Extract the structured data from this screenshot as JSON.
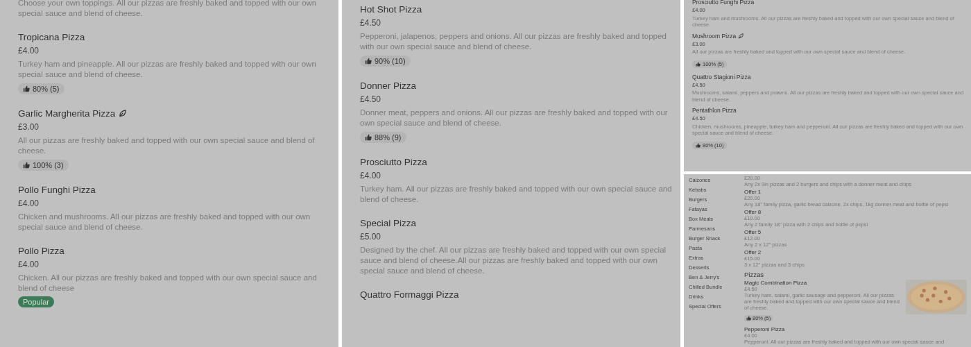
{
  "panels": [
    {
      "items": [
        {
          "description": "Choose your own toppings. All our pizzas are freshly baked and topped with our own special sauce and blend of cheese."
        },
        {
          "name": "Tropicana Pizza",
          "vegetarian": false,
          "price": "£4.00",
          "description": "Turkey ham and pineapple. All our pizzas are freshly baked and topped with our own special sauce and blend of cheese.",
          "rating": "80% (5)"
        },
        {
          "name": "Garlic Margherita Pizza",
          "vegetarian": true,
          "price": "£3.00",
          "description": "All our pizzas are freshly baked and topped with our own special sauce and blend of cheese.",
          "rating": "100% (3)"
        },
        {
          "name": "Pollo Funghi Pizza",
          "vegetarian": false,
          "price": "£4.00",
          "description": "Chicken and mushrooms. All our pizzas are freshly baked and topped with our own special sauce and blend of cheese."
        },
        {
          "name": "Pollo Pizza",
          "vegetarian": false,
          "price": "£4.00",
          "description": "Chicken. All our pizzas are freshly baked and topped with our own special sauce and blend of cheese",
          "badge": "Popular"
        }
      ]
    },
    {
      "items": [
        {
          "name": "Hot Shot Pizza",
          "vegetarian": false,
          "price": "£4.50",
          "description": "Pepperoni, jalapenos, peppers and onions. All our pizzas are freshly baked and topped with our own special sauce and blend of cheese.",
          "rating": "90% (10)"
        },
        {
          "name": "Donner Pizza",
          "vegetarian": false,
          "price": "£4.50",
          "description": "Donner meat, peppers and onions. All our pizzas are freshly baked and topped with our own special sauce and blend of cheese.",
          "rating": "88% (9)"
        },
        {
          "name": "Prosciutto Pizza",
          "vegetarian": false,
          "price": "£4.00",
          "description": "Turkey ham. All our pizzas are freshly baked and topped with our own special sauce and blend of cheese."
        },
        {
          "name": "Special Pizza",
          "vegetarian": false,
          "price": "£5.00",
          "description": "Designed by the chef. All our pizzas are freshly baked and topped with our own special sauce and blend of cheese.All our pizzas are freshly baked and topped with our own special sauce and blend of cheese."
        },
        {
          "name": "Quattro Formaggi Pizza",
          "vegetarian": false
        }
      ]
    },
    {
      "items": [
        {
          "name": "Prosciutto Funghi Pizza",
          "vegetarian": false,
          "price": "£4.00",
          "description": "Turkey ham and mushrooms. All our pizzas are freshly baked and topped with our own special sauce and blend of cheese."
        },
        {
          "name": "Mushroom Pizza",
          "vegetarian": true,
          "price": "£3.00",
          "description": "All our pizzas are freshly baked and topped with our own special sauce and blend of cheese.",
          "rating": "100% (5)"
        },
        {
          "name": "Quattro Stagioni Pizza",
          "vegetarian": false,
          "price": "£4.50",
          "description": "Mushrooms, salami, peppers and prawns. All our pizzas are freshly baked and topped with our own special sauce and blend of cheese."
        },
        {
          "name": "Pentathlon Pizza",
          "vegetarian": false,
          "price": "£4.50",
          "description": "Chicken, mushrooms, pineapple, turkey ham and pepperoni. All our pizzas are freshly baked and topped with our own special sauce and blend of cheese.",
          "rating": "80% (10)"
        }
      ]
    }
  ],
  "menu_page": {
    "categories": [
      "Calzones",
      "Kebabs",
      "Burgers",
      "Fatayas",
      "Box Meals",
      "Parmesans",
      "Burger Shack",
      "Pasta",
      "Extras",
      "Desserts",
      "Ben & Jerry's",
      "Chilled Bundle",
      "Drinks",
      "Special Offers"
    ],
    "offers": [
      {
        "price": "£20.00",
        "description": "Any 2x 9in pizzas and 2 burgers and chips with a donner meat and chips"
      },
      {
        "name": "Offer 1",
        "price": "£20.00",
        "description": "Any 18\" family pizza, garlic bread calzone, 2x chips, 1kg donner meat and bottle of pepsi"
      },
      {
        "name": "Offer 8",
        "price": "£10.00",
        "description": "Any 2 family 18\" pizza with 2 chips and bottle of pepsi"
      },
      {
        "name": "Offer 5",
        "price": "£12.00",
        "description": "Any 2 x 12\" pizzas"
      },
      {
        "name": "Offer 2",
        "price": "£15.00",
        "description": "3 x 12\" pizzas and 3 chips"
      }
    ],
    "section_title": "Pizzas",
    "items": [
      {
        "name": "Magic Combination Pizza",
        "price": "£4.50",
        "description": "Turkey ham, salami, garlic sausage and pepperoni. All our pizzas are freshly baked and topped with our own special sauce and blend of cheese.",
        "rating": "80% (5)",
        "kind": "picture"
      },
      {
        "name": "Pepperoni Pizza",
        "price": "£4.00",
        "description": "Pepperoni. All our pizzas are freshly baked and topped with our own special sauce and"
      }
    ]
  }
}
